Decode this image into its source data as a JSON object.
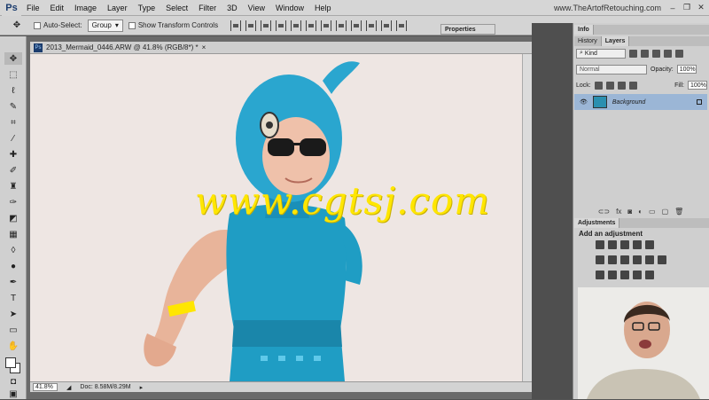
{
  "app": {
    "logo": "Ps",
    "site_url": "www.TheArtofRetouching.com"
  },
  "menu": [
    "File",
    "Edit",
    "Image",
    "Layer",
    "Type",
    "Select",
    "Filter",
    "3D",
    "View",
    "Window",
    "Help"
  ],
  "window_controls": {
    "minimize": "–",
    "restore": "❐",
    "close": "✕"
  },
  "options": {
    "tool_glyph": "✥",
    "auto_select_label": "Auto-Select:",
    "auto_select_value": "Group",
    "show_transform_label": "Show Transform Controls"
  },
  "document": {
    "tab_title": "2013_Mermaid_0446.ARW @ 41.8% (RGB/8*) *",
    "tab_close": "×",
    "watermark": "www.cgtsj.com",
    "zoom": "41.8%",
    "doc_size": "Doc: 8.58M/8.29M"
  },
  "panels": {
    "properties_tab": "Properties",
    "info_tab": "Info",
    "history_tab": "History",
    "layers_tab": "Layers",
    "kind_label": "Kind",
    "blend_mode": "Normal",
    "opacity_label": "Opacity:",
    "opacity_value": "100%",
    "lock_label": "Lock:",
    "fill_label": "Fill:",
    "fill_value": "100%",
    "layer_name": "Background",
    "adjustments_tab": "Adjustments",
    "add_adjustment": "Add an adjustment"
  },
  "colors": {
    "accent_blue": "#9bb6d6",
    "watermark_yellow": "#ffe600",
    "costume_teal": "#1f9dc4"
  }
}
